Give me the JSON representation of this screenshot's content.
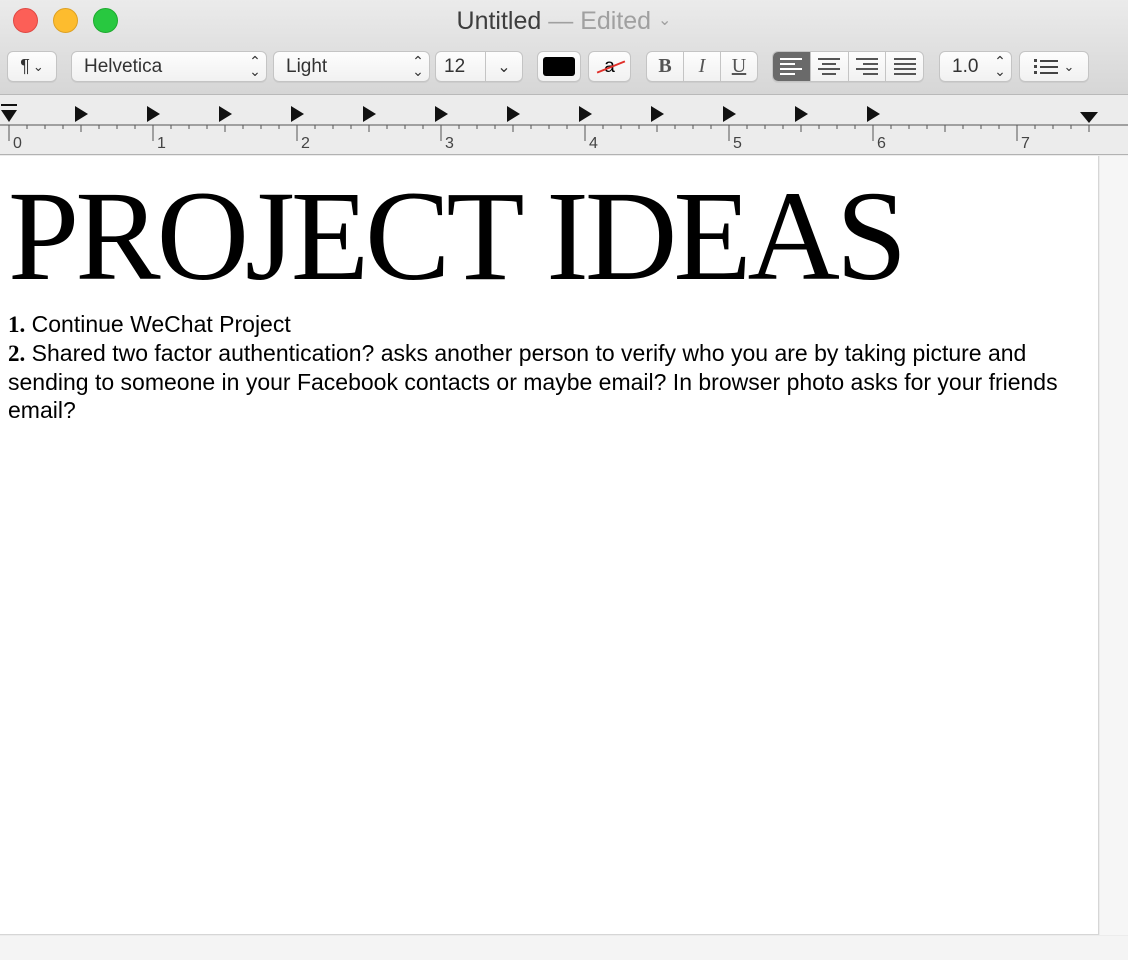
{
  "window": {
    "title": "Untitled",
    "separator": "—",
    "status": "Edited",
    "status_chevron": "chevron-down-icon"
  },
  "toolbar": {
    "paragraph_icon": "¶",
    "font_family": "Helvetica",
    "font_style": "Light",
    "font_size": "12",
    "text_color": "#000000",
    "highlight_letter": "a",
    "bold": "B",
    "italic": "I",
    "underline": "U",
    "alignment_active": "left",
    "line_spacing": "1.0",
    "list_icon": "list-icon"
  },
  "ruler": {
    "labels": [
      "0",
      "1",
      "2",
      "3",
      "4",
      "5",
      "6",
      "7"
    ]
  },
  "document": {
    "heading": "PROJECT IDEAS",
    "item1_number": "1.",
    "item1_text": "Continue WeChat Project",
    "item2_number": "2.",
    "item2_text": "Shared two factor authentication? asks another person to verify who you are by taking picture and sending to someone in your Facebook contacts or maybe email? In browser photo asks for your friends email?"
  }
}
